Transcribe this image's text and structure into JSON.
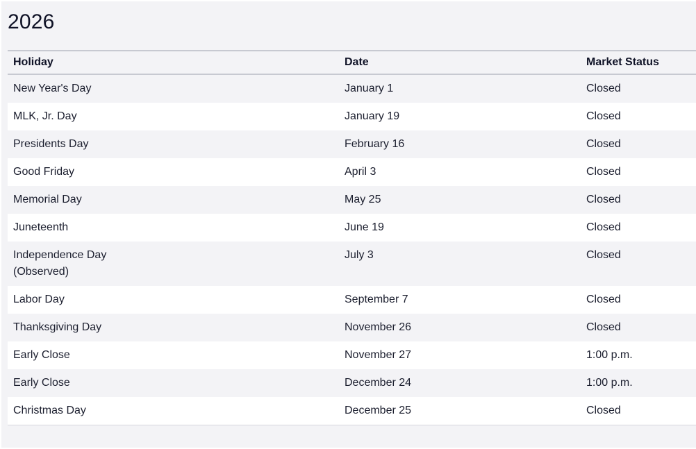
{
  "year": "2026",
  "table": {
    "headers": {
      "holiday": "Holiday",
      "date": "Date",
      "status": "Market Status"
    },
    "rows": [
      {
        "holiday": "New Year's Day",
        "date": "January 1",
        "status": "Closed"
      },
      {
        "holiday": "MLK, Jr. Day",
        "date": "January 19",
        "status": "Closed"
      },
      {
        "holiday": "Presidents Day",
        "date": "February 16",
        "status": "Closed"
      },
      {
        "holiday": "Good Friday",
        "date": "April 3",
        "status": "Closed"
      },
      {
        "holiday": "Memorial Day",
        "date": "May 25",
        "status": "Closed"
      },
      {
        "holiday": "Juneteenth",
        "date": "June 19",
        "status": "Closed"
      },
      {
        "holiday": "Independence Day (Observed)",
        "date": "July 3",
        "status": "Closed"
      },
      {
        "holiday": "Labor Day",
        "date": "September 7",
        "status": "Closed"
      },
      {
        "holiday": "Thanksgiving Day",
        "date": "November 26",
        "status": "Closed"
      },
      {
        "holiday": "Early Close",
        "date": "November 27",
        "status": "1:00 p.m."
      },
      {
        "holiday": "Early Close",
        "date": "December 24",
        "status": "1:00 p.m."
      },
      {
        "holiday": "Christmas Day",
        "date": "December 25",
        "status": "Closed"
      }
    ]
  }
}
